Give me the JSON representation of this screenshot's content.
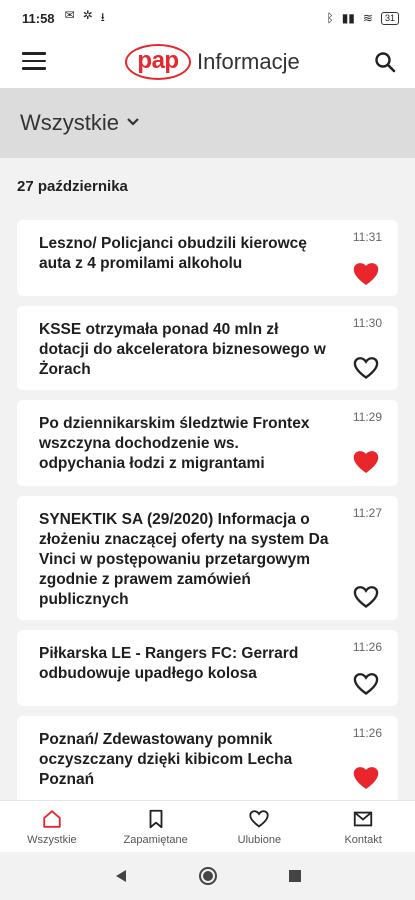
{
  "status_bar": {
    "time": "11:58",
    "battery": "31"
  },
  "app_bar": {
    "logo_text": "pap",
    "title": "Informacje"
  },
  "filter": {
    "label": "Wszystkie"
  },
  "date_header": "27 października",
  "articles": [
    {
      "title": "Leszno/ Policjanci obudzili kierowcę auta z 4 promilami alkoholu",
      "time": "11:31",
      "favorite": true
    },
    {
      "title": "KSSE otrzymała ponad 40 mln zł dotacji do akceleratora biznesowego w Żorach",
      "time": "11:30",
      "favorite": false
    },
    {
      "title": "Po dziennikarskim śledztwie Frontex wszczyna dochodzenie ws. odpychania łodzi z migrantami",
      "time": "11:29",
      "favorite": true
    },
    {
      "title": "SYNEKTIK SA (29/2020) Informacja o złożeniu znaczącej oferty na system Da Vinci w postępowaniu przetargowym zgodnie z prawem zamówień publicznych",
      "time": "11:27",
      "favorite": false
    },
    {
      "title": "Piłkarska LE - Rangers FC: Gerrard odbudowuje upadłego kolosa",
      "time": "11:26",
      "favorite": false
    },
    {
      "title": "Poznań/ Zdewastowany pomnik oczyszczany dzięki kibicom Lecha Poznań",
      "time": "11:26",
      "favorite": true
    }
  ],
  "bottom_nav": [
    {
      "label": "Wszystkie",
      "icon": "home-icon",
      "active": true
    },
    {
      "label": "Zapamiętane",
      "icon": "bookmark-icon",
      "active": false
    },
    {
      "label": "Ulubione",
      "icon": "heart-icon",
      "active": false
    },
    {
      "label": "Kontakt",
      "icon": "mail-icon",
      "active": false
    }
  ],
  "colors": {
    "accent": "#e8262b",
    "favorite": "#e8262b",
    "header_bg": "#dcdcdc",
    "page_bg": "#f2f2f2"
  }
}
